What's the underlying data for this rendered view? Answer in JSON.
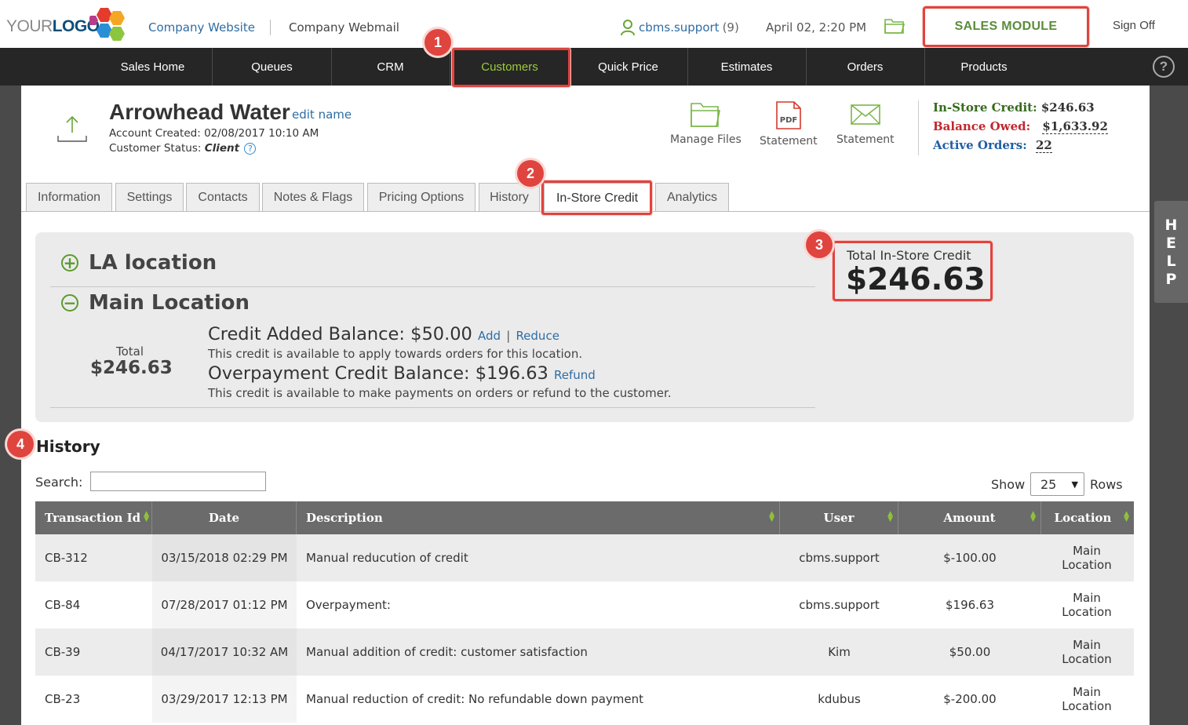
{
  "top": {
    "logo": {
      "part1": "YOUR",
      "part2": "LOGO"
    },
    "company_website": "Company Website",
    "company_webmail": "Company Webmail",
    "user_name": "cbms.support",
    "user_count": "(9)",
    "datetime": "April 02, 2:20 PM",
    "module": "SALES MODULE",
    "sign_off": "Sign Off"
  },
  "nav": [
    "Sales Home",
    "Queues",
    "CRM",
    "Customers",
    "Quick Price",
    "Estimates",
    "Orders",
    "Products"
  ],
  "help_nav": "?",
  "help_tab": [
    "H",
    "E",
    "L",
    "P"
  ],
  "customer": {
    "name": "Arrowhead Water",
    "edit_name": "edit name",
    "created": "Account Created: 02/08/2017 10:10 AM",
    "status_label": "Customer Status:",
    "status_value": "Client",
    "status_help": "?"
  },
  "actions": {
    "manage_files": "Manage Files",
    "statement_pdf": "Statement",
    "statement_email": "Statement",
    "pdf_glyph": "PDF"
  },
  "stats": {
    "in_store_label": "In-Store Credit:",
    "in_store_value": "$246.63",
    "balance_label": "Balance Owed:",
    "balance_value": "$1,633.92",
    "active_label": "Active Orders:",
    "active_value": "22"
  },
  "tabs": [
    "Information",
    "Settings",
    "Contacts",
    "Notes & Flags",
    "Pricing Options",
    "History",
    "In-Store Credit",
    "Analytics"
  ],
  "badges": [
    "1",
    "2",
    "3",
    "4"
  ],
  "panel": {
    "loc_la": "LA location",
    "loc_main": "Main Location",
    "plus": "+",
    "minus": "−",
    "total_label": "Total",
    "total_value": "$246.63",
    "credit_added": "Credit Added Balance: $50.00",
    "add": "Add",
    "pipe": "|",
    "reduce": "Reduce",
    "credit_added_desc": "This credit is available to apply towards orders for this location.",
    "overpay": "Overpayment Credit Balance: $196.63",
    "refund": "Refund",
    "overpay_desc": "This credit is available to make payments on orders or refund to the customer.",
    "total_box_label": "Total In-Store Credit",
    "total_box_value": "$246.63"
  },
  "history": {
    "title": "History",
    "search_label": "Search:",
    "search_value": "",
    "show_label": "Show",
    "show_value": "25",
    "rows_label": "Rows",
    "columns": [
      "Transaction Id",
      "Date",
      "Description",
      "User",
      "Amount",
      "Location"
    ],
    "rows": [
      {
        "id": "CB-312",
        "date": "03/15/2018 02:29 PM",
        "desc": "Manual reducution of credit",
        "user": "cbms.support",
        "amount": "$-100.00",
        "location": "Main Location"
      },
      {
        "id": "CB-84",
        "date": "07/28/2017 01:12 PM",
        "desc": "Overpayment:",
        "user": "cbms.support",
        "amount": "$196.63",
        "location": "Main Location"
      },
      {
        "id": "CB-39",
        "date": "04/17/2017 10:32 AM",
        "desc": "Manual addition of credit: customer satisfaction",
        "user": "Kim",
        "amount": "$50.00",
        "location": "Main Location"
      },
      {
        "id": "CB-23",
        "date": "03/29/2017 12:13 PM",
        "desc": "Manual reduction of credit: No refundable down payment",
        "user": "kdubus",
        "amount": "$-200.00",
        "location": "Main Location"
      }
    ]
  },
  "colors": {
    "accent_green": "#9ccc3c",
    "highlight_red": "#e0443e",
    "link_blue": "#2e6da4",
    "nav_bg": "#262626"
  },
  "icons": {
    "logo": "hexagon-cluster-icon",
    "user": "user-icon",
    "folder": "folder-icon",
    "upload": "upload-icon",
    "pdf": "pdf-file-icon",
    "mail": "envelope-icon",
    "sort": "sort-arrows-icon",
    "expand": "plus-circle-icon",
    "collapse": "minus-circle-icon"
  }
}
